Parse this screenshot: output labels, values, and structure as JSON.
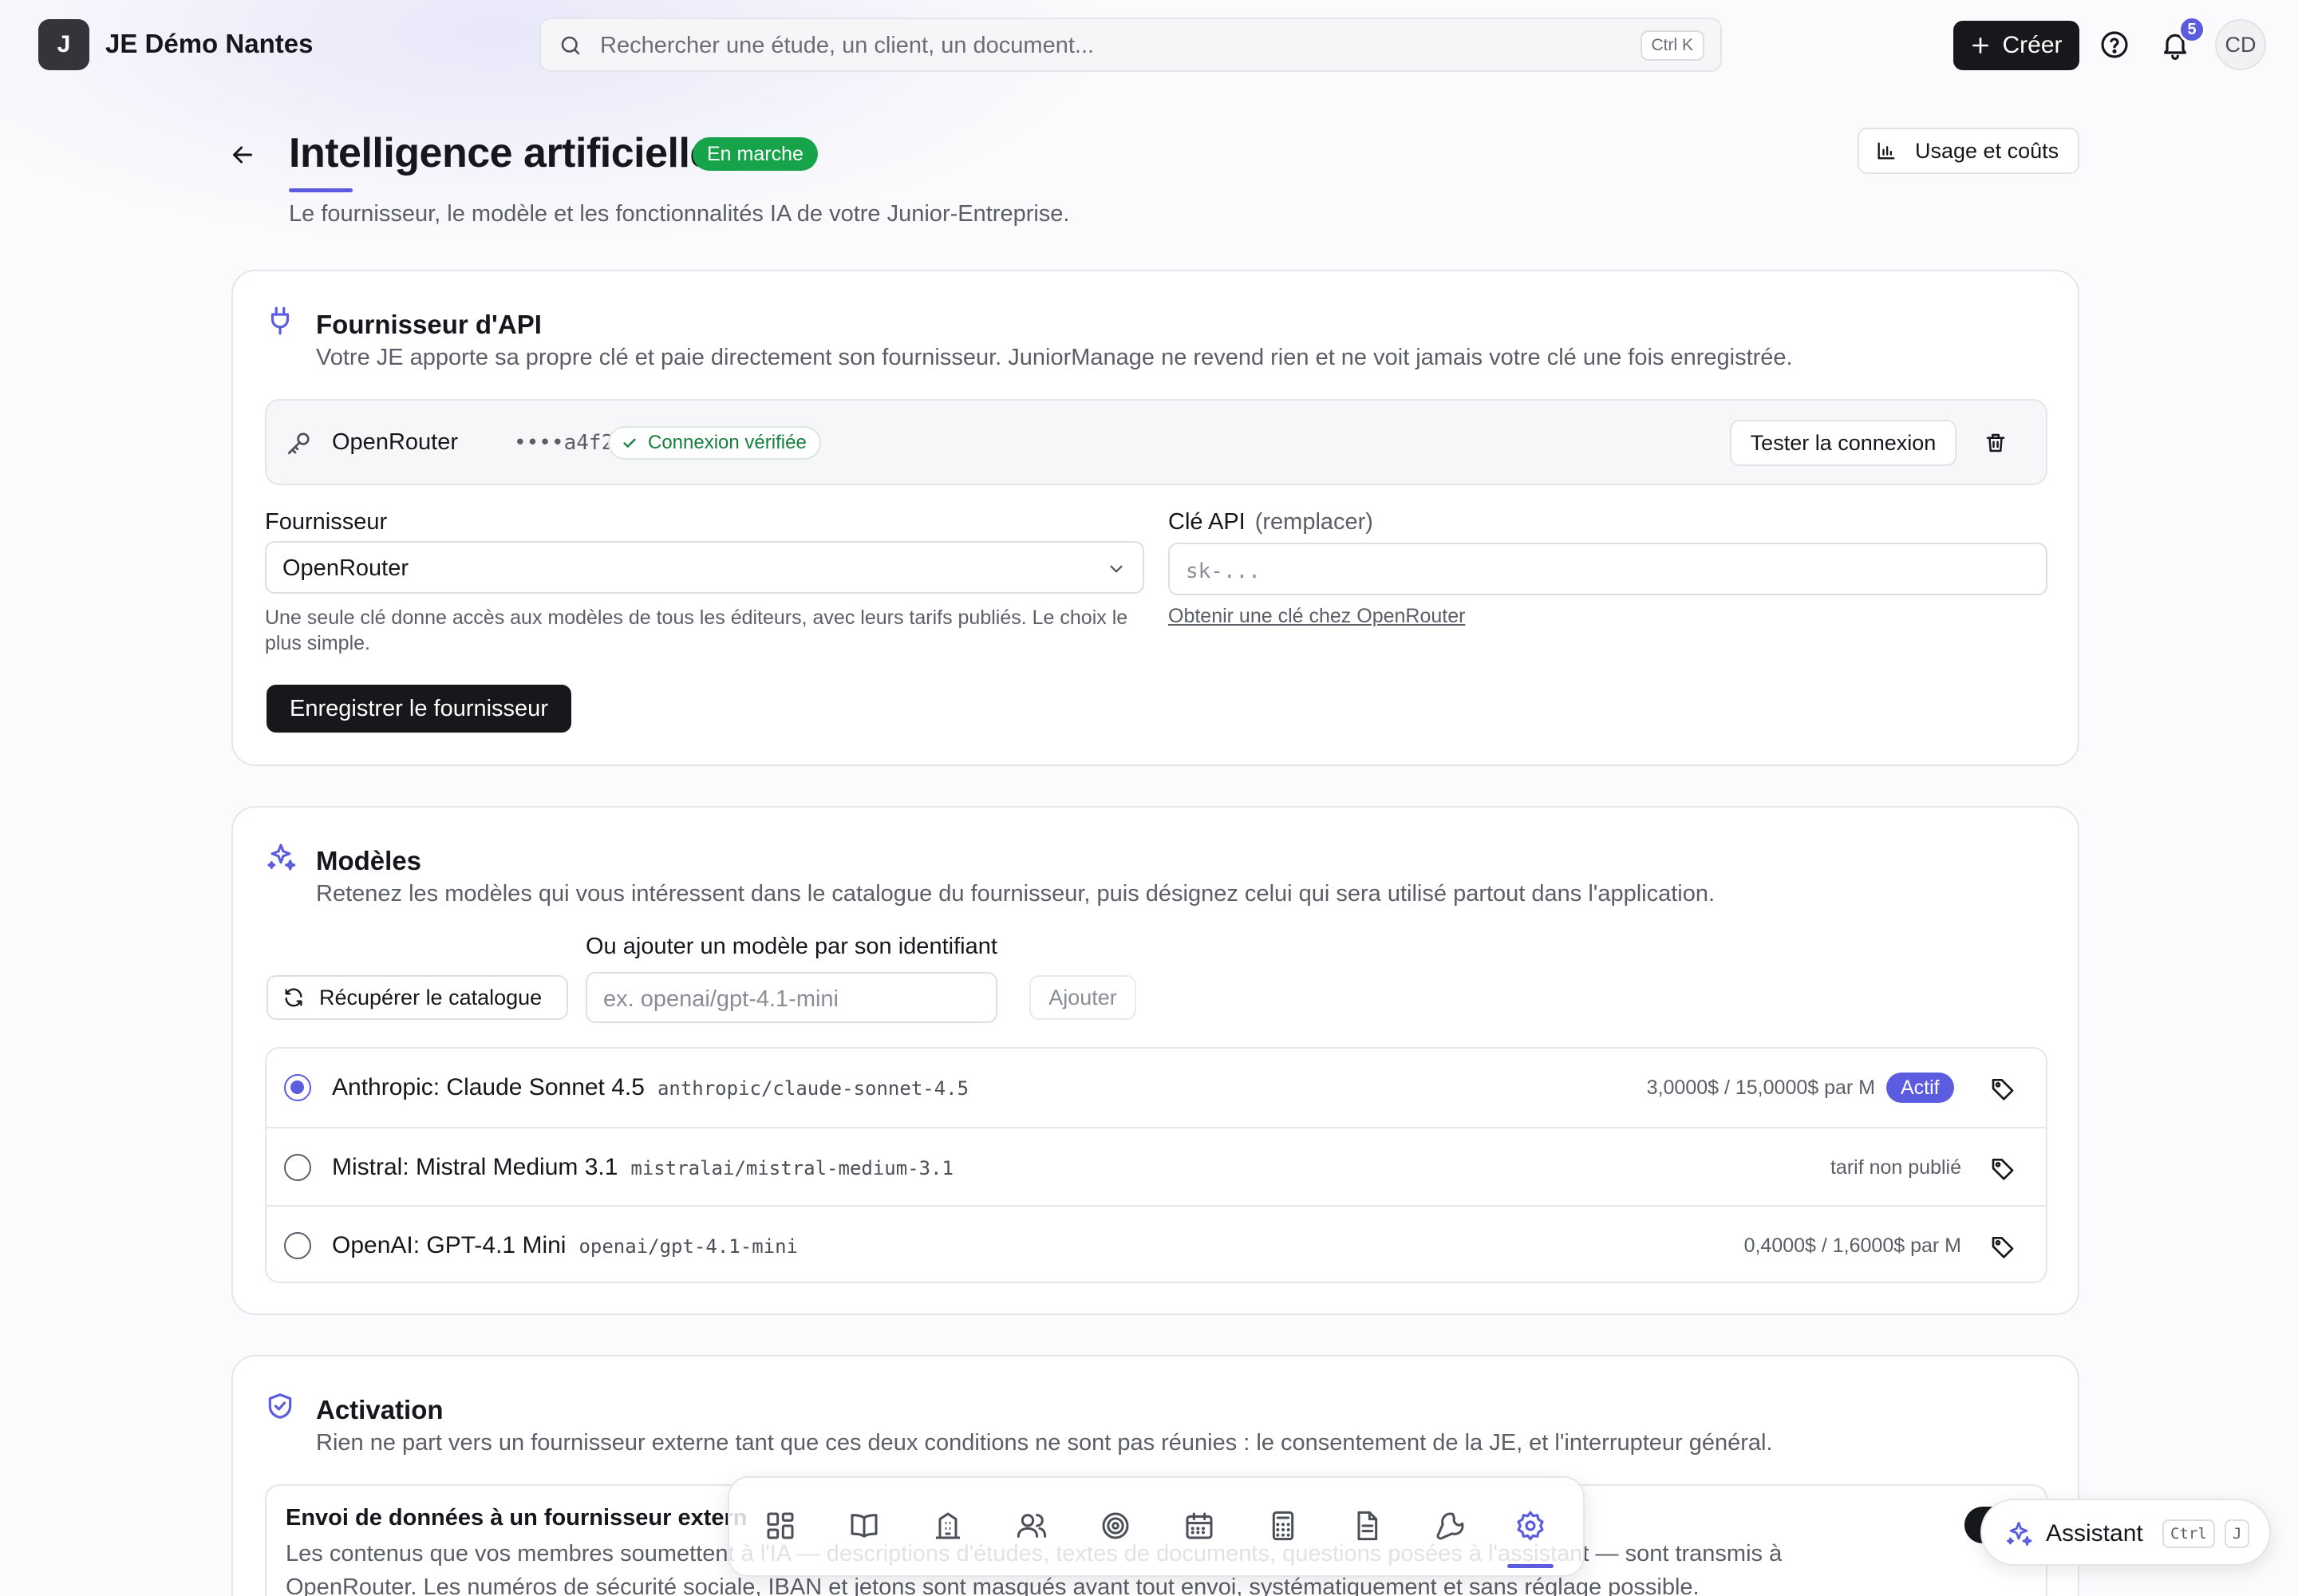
{
  "org": {
    "logo_letter": "J",
    "name": "JE Démo Nantes"
  },
  "search": {
    "placeholder": "Rechercher une étude, un client, un document...",
    "shortcut": "Ctrl K"
  },
  "header_actions": {
    "create_label": "Créer",
    "notifications_count": "5",
    "avatar_initials": "CD"
  },
  "page": {
    "title": "Intelligence artificielle",
    "status": "En marche",
    "subtitle": "Le fournisseur, le modèle et les fonctionnalités IA de votre Junior-Entreprise.",
    "usage_button": "Usage et coûts"
  },
  "provider": {
    "title": "Fournisseur d'API",
    "description": "Votre JE apporte sa propre clé et paie directement son fournisseur. JuniorManage ne revend rien et ne voit jamais votre clé une fois enregistrée.",
    "connection": {
      "name": "OpenRouter",
      "masked_key": "••••a4f2",
      "status": "Connexion vérifiée",
      "test_button": "Tester la connexion"
    },
    "provider_field": {
      "label": "Fournisseur",
      "value": "OpenRouter",
      "help": "Une seule clé donne accès aux modèles de tous les éditeurs, avec leurs tarifs publiés. Le choix le plus simple."
    },
    "key_field": {
      "label": "Clé API",
      "hint": "(remplacer)",
      "placeholder": "sk-...",
      "link": "Obtenir une clé chez OpenRouter"
    },
    "save_button": "Enregistrer le fournisseur"
  },
  "models": {
    "title": "Modèles",
    "description": "Retenez les modèles qui vous intéressent dans le catalogue du fournisseur, puis désignez celui qui sera utilisé partout dans l'application.",
    "fetch_button": "Récupérer le catalogue",
    "add_label": "Ou ajouter un modèle par son identifiant",
    "add_placeholder": "ex. openai/gpt-4.1-mini",
    "add_button": "Ajouter",
    "items": [
      {
        "name": "Anthropic: Claude Sonnet 4.5",
        "id": "anthropic/claude-sonnet-4.5",
        "price": "3,0000$ / 15,0000$ par M",
        "active_label": "Actif",
        "selected": true
      },
      {
        "name": "Mistral: Mistral Medium 3.1",
        "id": "mistralai/mistral-medium-3.1",
        "price": "tarif non publié",
        "selected": false
      },
      {
        "name": "OpenAI: GPT-4.1 Mini",
        "id": "openai/gpt-4.1-mini",
        "price": "0,4000$ / 1,6000$ par M",
        "selected": false
      }
    ]
  },
  "activation": {
    "title": "Activation",
    "description": "Rien ne part vers un fournisseur externe tant que ces deux conditions ne sont pas réunies : le consentement de la JE, et l'interrupteur général.",
    "consent": {
      "title": "Envoi de données à un fournisseur extern",
      "description": "Les contenus que vos membres soumettent à l'IA — descriptions d'études, textes de documents, questions posées à l'assistant — sont transmis à OpenRouter. Les numéros de sécurité sociale, IBAN et jetons sont masqués avant tout envoi, systématiquement et sans réglage possible.",
      "enabled": true
    }
  },
  "dock": {
    "items": [
      "dashboard-icon",
      "book-icon",
      "building-icon",
      "users-icon",
      "target-icon",
      "calendar-icon",
      "calculator-icon",
      "document-icon",
      "wrench-icon",
      "settings-icon"
    ],
    "active": "settings-icon"
  },
  "assistant": {
    "label": "Assistant",
    "shortcut_mod": "Ctrl",
    "shortcut_key": "J"
  },
  "colors": {
    "accent": "#5b5ce0",
    "success": "#16a34a",
    "dark": "#17181c"
  }
}
